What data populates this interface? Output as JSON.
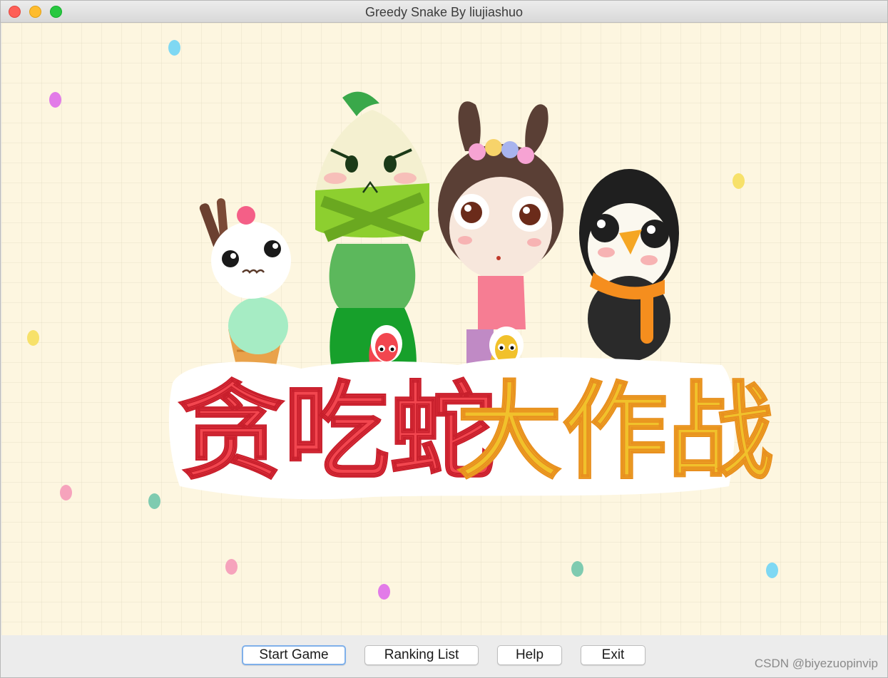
{
  "window": {
    "title": "Greedy Snake By liujiashuo"
  },
  "splash": {
    "logo_text_red": "贪吃蛇",
    "logo_text_yellow": "大作战",
    "colors": {
      "background": "#fdf6e0",
      "logo_red": "#f2464f",
      "logo_yellow": "#f1c12b",
      "outline": "#ffffff"
    }
  },
  "buttons": {
    "start": "Start Game",
    "ranking": "Ranking List",
    "help": "Help",
    "exit": "Exit"
  },
  "watermark": "CSDN @biyezuopinvip"
}
